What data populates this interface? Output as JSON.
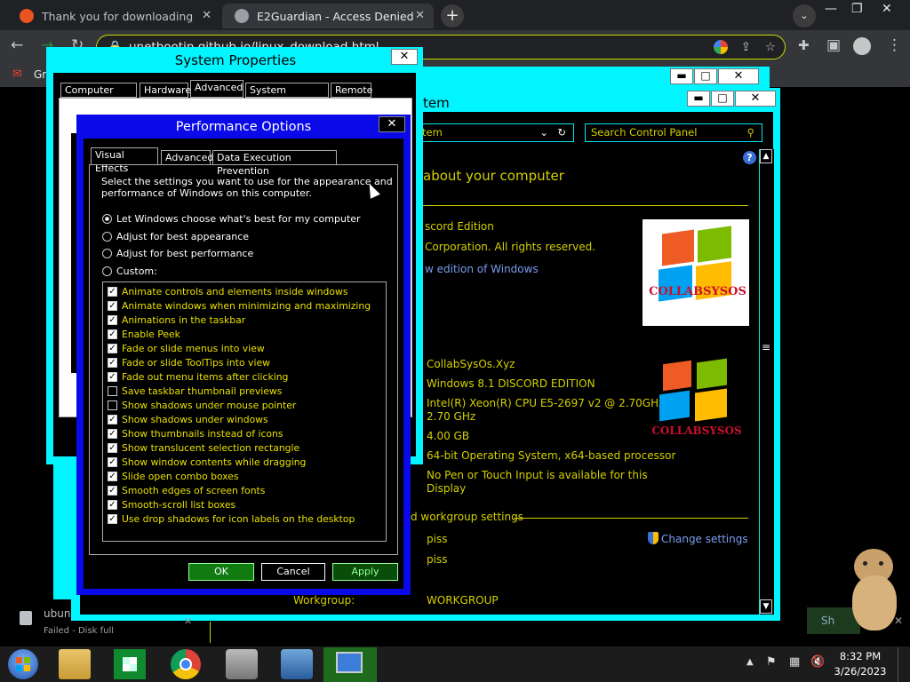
{
  "browser": {
    "tabs": [
      {
        "title": "Thank you for downloading Ubu",
        "favicon_color": "#e95420"
      },
      {
        "title": "E2Guardian - Access Denied",
        "favicon_color": "#9aa0a6"
      }
    ],
    "address": "unetbootin.github.io/linux_download.html",
    "bookmark": "Gm"
  },
  "control_panel": {
    "title_fragment": "tem",
    "address_fragment": "tem",
    "search_placeholder": "Search Control Panel",
    "heading": "about your computer",
    "edition": "scord Edition",
    "copyright": "Corporation. All rights reserved.",
    "new_edition_link": "w edition of Windows",
    "logo_text": "COLLABSYSOS",
    "system_values": [
      "CollabSysOs.Xyz",
      "Windows 8.1 DISCORD EDITION",
      "Intel(R) Xeon(R) CPU E5-2697 v2 @ 2.70GHz",
      "2.70 GHz",
      "4.00 GB",
      "64-bit Operating System, x64-based processor",
      "No Pen or Touch Input is available for this",
      "Display"
    ],
    "workgroup_section": "d workgroup settings",
    "name_values": [
      "piss",
      "piss"
    ],
    "change_settings": "Change settings",
    "workgroup_label": "Workgroup:",
    "workgroup_value": "WORKGROUP"
  },
  "system_properties": {
    "title": "System Properties",
    "tabs": [
      "Computer Name",
      "Hardware",
      "Advanced",
      "System Protection",
      "Remote"
    ]
  },
  "performance_options": {
    "title": "Performance Options",
    "tabs": [
      "Visual Effects",
      "Advanced",
      "Data Execution Prevention"
    ],
    "description_line1": "Select the settings you want to use for the appearance and",
    "description_line2": "performance of Windows on this computer.",
    "radios": [
      {
        "label": "Let Windows choose what's best for my computer",
        "selected": true
      },
      {
        "label": "Adjust for best appearance",
        "selected": false
      },
      {
        "label": "Adjust for best performance",
        "selected": false
      },
      {
        "label": "Custom:",
        "selected": false
      }
    ],
    "effects": [
      {
        "label": "Animate controls and elements inside windows",
        "checked": true
      },
      {
        "label": "Animate windows when minimizing and maximizing",
        "checked": true
      },
      {
        "label": "Animations in the taskbar",
        "checked": true
      },
      {
        "label": "Enable Peek",
        "checked": true
      },
      {
        "label": "Fade or slide menus into view",
        "checked": true
      },
      {
        "label": "Fade or slide ToolTips into view",
        "checked": true
      },
      {
        "label": "Fade out menu items after clicking",
        "checked": true
      },
      {
        "label": "Save taskbar thumbnail previews",
        "checked": false
      },
      {
        "label": "Show shadows under mouse pointer",
        "checked": false
      },
      {
        "label": "Show shadows under windows",
        "checked": true
      },
      {
        "label": "Show thumbnails instead of icons",
        "checked": true
      },
      {
        "label": "Show translucent selection rectangle",
        "checked": true
      },
      {
        "label": "Show window contents while dragging",
        "checked": true
      },
      {
        "label": "Slide open combo boxes",
        "checked": true
      },
      {
        "label": "Smooth edges of screen fonts",
        "checked": true
      },
      {
        "label": "Smooth-scroll list boxes",
        "checked": true
      },
      {
        "label": "Use drop shadows for icon labels on the desktop",
        "checked": true
      }
    ],
    "ok": "OK",
    "cancel": "Cancel",
    "apply": "Apply"
  },
  "download": {
    "name": "ubun",
    "status": "Failed - Disk full",
    "show_all": "Sh"
  },
  "taskbar": {
    "time": "8:32 PM",
    "date": "3/26/2023"
  }
}
